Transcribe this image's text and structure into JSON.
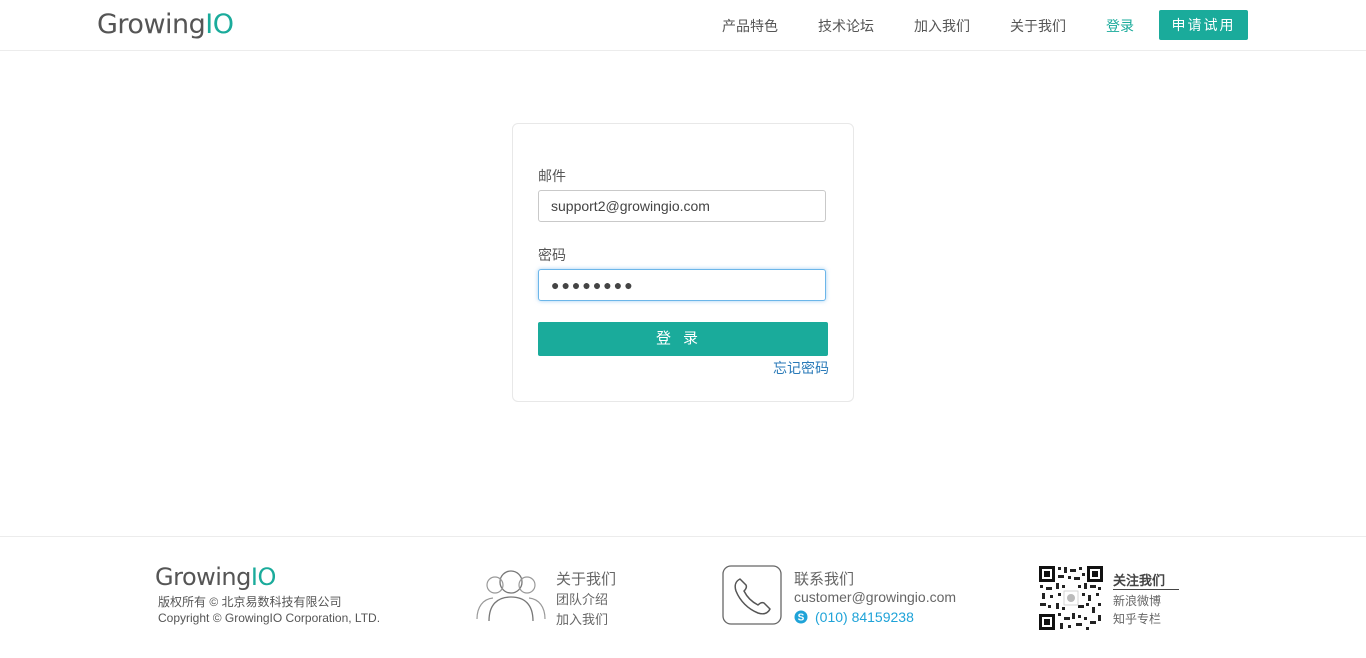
{
  "header": {
    "logo_text_main": "Growing",
    "logo_text_accent": "IO",
    "nav": [
      "产品特色",
      "技术论坛",
      "加入我们",
      "关于我们"
    ],
    "login_label": "登录",
    "trial_label": "申请试用"
  },
  "login_form": {
    "email_label": "邮件",
    "email_value": "support2@growingio.com",
    "password_label": "密码",
    "password_value": "●●●●●●●●",
    "submit_label": "登录",
    "forgot_label": "忘记密码"
  },
  "footer": {
    "logo_text_main": "Growing",
    "logo_text_accent": "IO",
    "copyright_cn": "版权所有 © 北京易数科技有限公司",
    "copyright_en": "Copyright © GrowingIO Corporation, LTD.",
    "about": {
      "title": "关于我们",
      "links": [
        "团队介绍",
        "加入我们"
      ]
    },
    "contact": {
      "title": "联系我们",
      "email": "customer@growingio.com",
      "phone": "(010) 84159238"
    },
    "follow": {
      "title": "关注我们",
      "links": [
        "新浪微博",
        "知乎专栏"
      ]
    }
  },
  "colors": {
    "brand": "#1aab9b",
    "link": "#2a7ab8",
    "phone": "#1fa3d8"
  },
  "icons": [
    "people-icon",
    "phone-icon",
    "skype-icon",
    "qr-code"
  ]
}
